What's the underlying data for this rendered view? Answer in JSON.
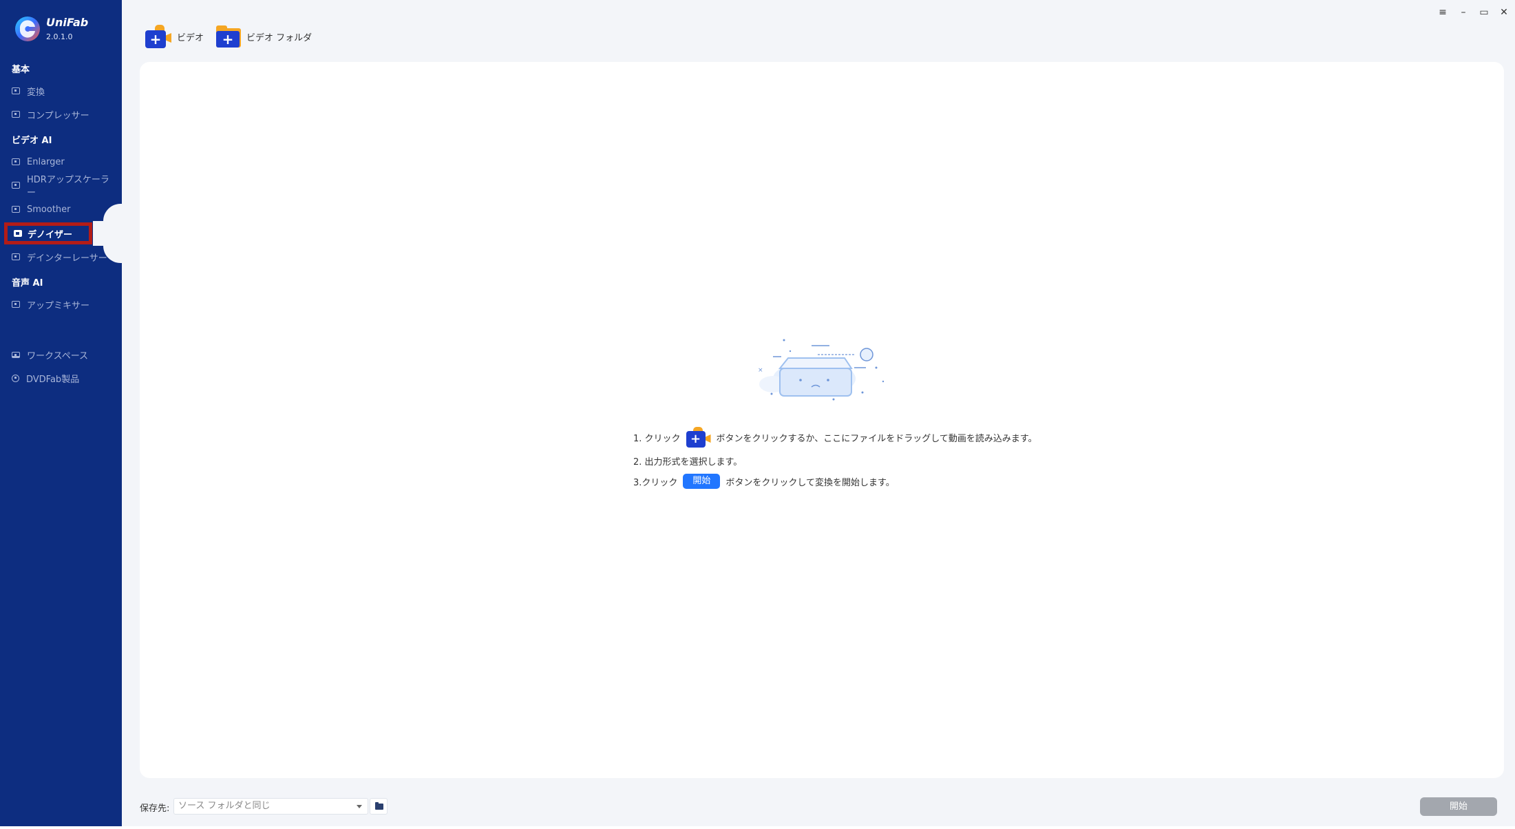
{
  "app": {
    "name": "UniFab",
    "version": "2.0.1.0"
  },
  "sidebar": {
    "sections": [
      {
        "title": "基本",
        "items": [
          {
            "label": "変換",
            "icon": "play-icon"
          },
          {
            "label": "コンプレッサー",
            "icon": "compress-icon"
          }
        ]
      },
      {
        "title": "ビデオ AI",
        "items": [
          {
            "label": "Enlarger",
            "icon": "enlarge-icon"
          },
          {
            "label": "HDRアップスケーラー",
            "icon": "hdr-icon"
          },
          {
            "label": "Smoother",
            "icon": "smoother-icon"
          },
          {
            "label": "デノイザー",
            "icon": "denoise-icon",
            "active": true
          },
          {
            "label": "デインターレーサー",
            "icon": "deinterlace-icon"
          }
        ]
      },
      {
        "title": "音声 AI",
        "items": [
          {
            "label": "アップミキサー",
            "icon": "upmix-icon"
          }
        ]
      }
    ],
    "bottom_items": [
      {
        "label": "ワークスペース",
        "icon": "monitor-icon"
      },
      {
        "label": "DVDFab製品",
        "icon": "dvdfab-icon"
      }
    ]
  },
  "toolbar": {
    "add_video_label": "ビデオ",
    "add_folder_label": "ビデオ フォルダ"
  },
  "instructions": {
    "step1_prefix": "1. クリック",
    "step1_suffix": "ボタンをクリックするか、ここにファイルをドラッグして動画を読み込みます。",
    "step2": "2. 出力形式を選択します。",
    "step3_prefix": "3.クリック",
    "step3_button": "開始",
    "step3_suffix": "ボタンをクリックして変換を開始します。"
  },
  "footer": {
    "save_label": "保存先:",
    "save_value": "ソース フォルダと同じ",
    "start_label": "開始"
  },
  "colors": {
    "sidebar_bg": "#0d2d80",
    "accent_blue": "#1e3fcf",
    "accent_orange": "#f5a623",
    "start_inline": "#2176ff",
    "start_disabled": "#a3a7ae",
    "highlight_border": "#b31c17"
  }
}
